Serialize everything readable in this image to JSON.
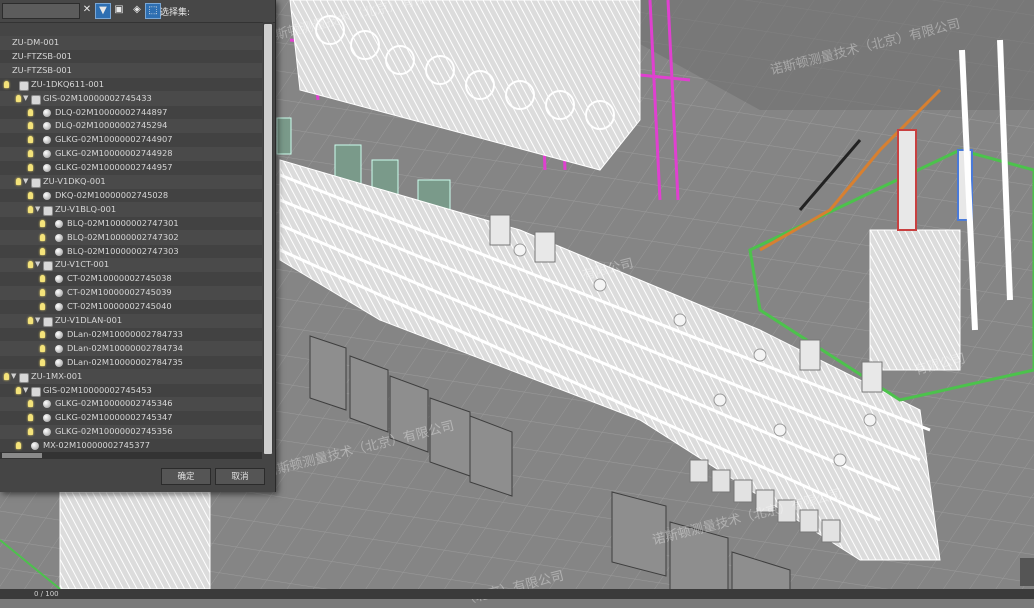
{
  "dialog": {
    "search": {
      "placeholder": "",
      "value": ""
    },
    "toolbar": {
      "clear_icon": "close-icon",
      "filter_icon": "filter-icon",
      "display_icon": "display-icon",
      "layers_icon": "layers-icon",
      "select_icon": "select-icon",
      "select_label": "选择集:"
    },
    "tree": [
      {
        "label": "ZU-DM-001",
        "depth": 0,
        "icon": "none",
        "bulb": false,
        "toggle": ""
      },
      {
        "label": "ZU-FTZSB-001",
        "depth": 0,
        "icon": "none",
        "bulb": false,
        "toggle": ""
      },
      {
        "label": "ZU-FTZSB-001",
        "depth": 0,
        "icon": "none",
        "bulb": false,
        "toggle": ""
      },
      {
        "label": "ZU-1DKQ611-001",
        "depth": 0,
        "icon": "group",
        "bulb": true,
        "toggle": ""
      },
      {
        "label": "GIS-02M10000002745433",
        "depth": 1,
        "icon": "group",
        "bulb": true,
        "toggle": "▼"
      },
      {
        "label": "DLQ-02M10000002744897",
        "depth": 2,
        "icon": "sphere",
        "bulb": true,
        "toggle": ""
      },
      {
        "label": "DLQ-02M10000002745294",
        "depth": 2,
        "icon": "sphere",
        "bulb": true,
        "toggle": ""
      },
      {
        "label": "GLKG-02M10000002744907",
        "depth": 2,
        "icon": "sphere",
        "bulb": true,
        "toggle": ""
      },
      {
        "label": "GLKG-02M10000002744928",
        "depth": 2,
        "icon": "sphere",
        "bulb": true,
        "toggle": ""
      },
      {
        "label": "GLKG-02M10000002744957",
        "depth": 2,
        "icon": "sphere",
        "bulb": true,
        "toggle": ""
      },
      {
        "label": "ZU-V1DKQ-001",
        "depth": 1,
        "icon": "group",
        "bulb": true,
        "toggle": "▼"
      },
      {
        "label": "DKQ-02M10000002745028",
        "depth": 2,
        "icon": "sphere",
        "bulb": true,
        "toggle": ""
      },
      {
        "label": "ZU-V1BLQ-001",
        "depth": 2,
        "icon": "group",
        "bulb": true,
        "toggle": "▼"
      },
      {
        "label": "BLQ-02M10000002747301",
        "depth": 3,
        "icon": "sphere",
        "bulb": true,
        "toggle": ""
      },
      {
        "label": "BLQ-02M10000002747302",
        "depth": 3,
        "icon": "sphere",
        "bulb": true,
        "toggle": ""
      },
      {
        "label": "BLQ-02M10000002747303",
        "depth": 3,
        "icon": "sphere",
        "bulb": true,
        "toggle": ""
      },
      {
        "label": "ZU-V1CT-001",
        "depth": 2,
        "icon": "group",
        "bulb": true,
        "toggle": "▼"
      },
      {
        "label": "CT-02M10000002745038",
        "depth": 3,
        "icon": "sphere",
        "bulb": true,
        "toggle": ""
      },
      {
        "label": "CT-02M10000002745039",
        "depth": 3,
        "icon": "sphere",
        "bulb": true,
        "toggle": ""
      },
      {
        "label": "CT-02M10000002745040",
        "depth": 3,
        "icon": "sphere",
        "bulb": true,
        "toggle": ""
      },
      {
        "label": "ZU-V1DLAN-001",
        "depth": 2,
        "icon": "group",
        "bulb": true,
        "toggle": "▼"
      },
      {
        "label": "DLan-02M10000002784733",
        "depth": 3,
        "icon": "sphere",
        "bulb": true,
        "toggle": ""
      },
      {
        "label": "DLan-02M10000002784734",
        "depth": 3,
        "icon": "sphere",
        "bulb": true,
        "toggle": ""
      },
      {
        "label": "DLan-02M10000002784735",
        "depth": 3,
        "icon": "sphere",
        "bulb": true,
        "toggle": ""
      },
      {
        "label": "ZU-1MX-001",
        "depth": 0,
        "icon": "group",
        "bulb": true,
        "toggle": "▼"
      },
      {
        "label": "GIS-02M10000002745453",
        "depth": 1,
        "icon": "group",
        "bulb": true,
        "toggle": "▼"
      },
      {
        "label": "GLKG-02M10000002745346",
        "depth": 2,
        "icon": "sphere",
        "bulb": true,
        "toggle": ""
      },
      {
        "label": "GLKG-02M10000002745347",
        "depth": 2,
        "icon": "sphere",
        "bulb": true,
        "toggle": ""
      },
      {
        "label": "GLKG-02M10000002745356",
        "depth": 2,
        "icon": "sphere",
        "bulb": true,
        "toggle": ""
      },
      {
        "label": "MX-02M10000002745377",
        "depth": 1,
        "icon": "sphere",
        "bulb": true,
        "toggle": ""
      }
    ],
    "ok_label": "确定",
    "cancel_label": "取消"
  },
  "status": {
    "frame_counter": "0 / 100"
  },
  "watermark": [
    "诺斯顿测量技术（北京）有限公司",
    "诺斯顿测量技术（北京）有限公司",
    "有限公司",
    "有限公司",
    "诺斯顿测量技术（北京）有限公司",
    "诺斯顿测量技术（北京）有限公司",
    "有限公司",
    "诺斯顿测量技术（北京）有限公司",
    "（北京）有限公司"
  ],
  "colors": {
    "structure_magenta": "#e040d0",
    "railing_orange": "#d88030",
    "railing_green": "#4cc24c",
    "insulator_red": "#c84040",
    "insulator_blue": "#4a7ad8"
  }
}
